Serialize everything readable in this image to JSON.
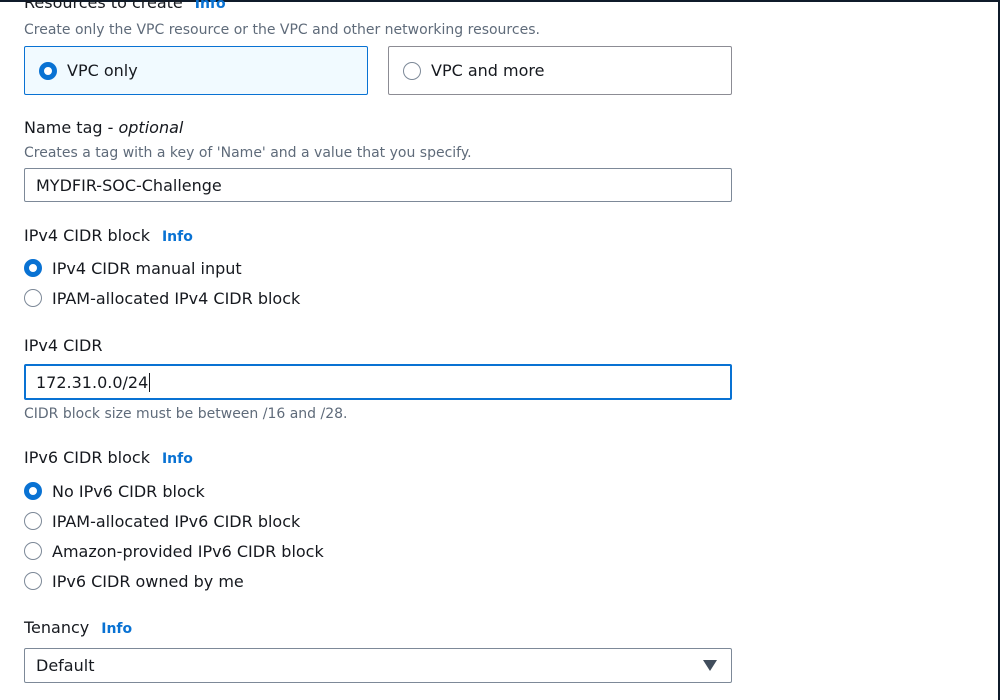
{
  "resources": {
    "label": "Resources to create",
    "info": "Info",
    "description": "Create only the VPC resource or the VPC and other networking resources.",
    "options": [
      {
        "label": "VPC only",
        "selected": true
      },
      {
        "label": "VPC and more",
        "selected": false
      }
    ]
  },
  "name_tag": {
    "label": "Name tag",
    "label_suffix": "optional",
    "description": "Creates a tag with a key of 'Name' and a value that you specify.",
    "value": "MYDFIR-SOC-Challenge"
  },
  "ipv4_block": {
    "label": "IPv4 CIDR block",
    "info": "Info",
    "options": [
      {
        "label": "IPv4 CIDR manual input",
        "selected": true
      },
      {
        "label": "IPAM-allocated IPv4 CIDR block",
        "selected": false
      }
    ]
  },
  "ipv4_cidr": {
    "label": "IPv4 CIDR",
    "value": "172.31.0.0/24",
    "hint": "CIDR block size must be between /16 and /28."
  },
  "ipv6_block": {
    "label": "IPv6 CIDR block",
    "info": "Info",
    "options": [
      {
        "label": "No IPv6 CIDR block",
        "selected": true
      },
      {
        "label": "IPAM-allocated IPv6 CIDR block",
        "selected": false
      },
      {
        "label": "Amazon-provided IPv6 CIDR block",
        "selected": false
      },
      {
        "label": "IPv6 CIDR owned by me",
        "selected": false
      }
    ]
  },
  "tenancy": {
    "label": "Tenancy",
    "info": "Info",
    "value": "Default"
  },
  "colors": {
    "accent": "#0972d3",
    "text": "#16191f",
    "muted": "#5f6b7a",
    "border": "#7d8998",
    "selected_bg": "#f1faff"
  }
}
